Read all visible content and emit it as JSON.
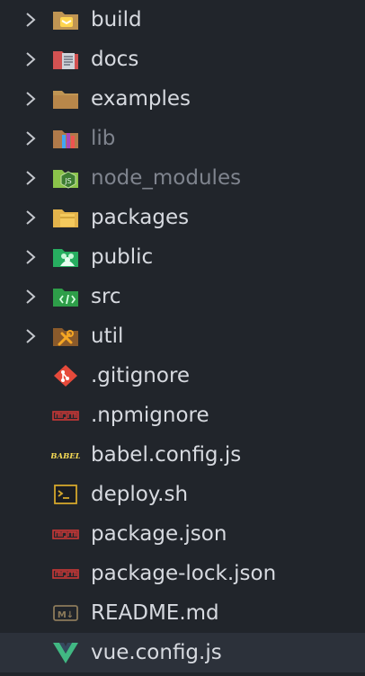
{
  "explorer": {
    "folders": [
      {
        "label": "build",
        "icon": "folder-build-icon",
        "dimmed": false
      },
      {
        "label": "docs",
        "icon": "folder-docs-icon",
        "dimmed": false
      },
      {
        "label": "examples",
        "icon": "folder-icon",
        "dimmed": false
      },
      {
        "label": "lib",
        "icon": "folder-lib-icon",
        "dimmed": true
      },
      {
        "label": "node_modules",
        "icon": "folder-node-icon",
        "dimmed": true
      },
      {
        "label": "packages",
        "icon": "folder-packages-icon",
        "dimmed": false
      },
      {
        "label": "public",
        "icon": "folder-public-icon",
        "dimmed": false
      },
      {
        "label": "src",
        "icon": "folder-src-icon",
        "dimmed": false
      },
      {
        "label": "util",
        "icon": "folder-util-icon",
        "dimmed": false
      }
    ],
    "files": [
      {
        "label": ".gitignore",
        "icon": "git-icon"
      },
      {
        "label": ".npmignore",
        "icon": "npm-icon"
      },
      {
        "label": "babel.config.js",
        "icon": "babel-icon",
        "icon_text": "BABEL"
      },
      {
        "label": "deploy.sh",
        "icon": "shell-icon"
      },
      {
        "label": "package.json",
        "icon": "npm-icon"
      },
      {
        "label": "package-lock.json",
        "icon": "npm-icon"
      },
      {
        "label": "README.md",
        "icon": "markdown-icon",
        "icon_text": "M↓"
      },
      {
        "label": "vue.config.js",
        "icon": "vue-icon",
        "selected": true
      }
    ]
  },
  "colors": {
    "background": "#21252b",
    "selected_row": "#2c313a",
    "text": "#d7dae0",
    "text_dimmed": "#7f848e",
    "chevron": "#c5c8ce"
  }
}
